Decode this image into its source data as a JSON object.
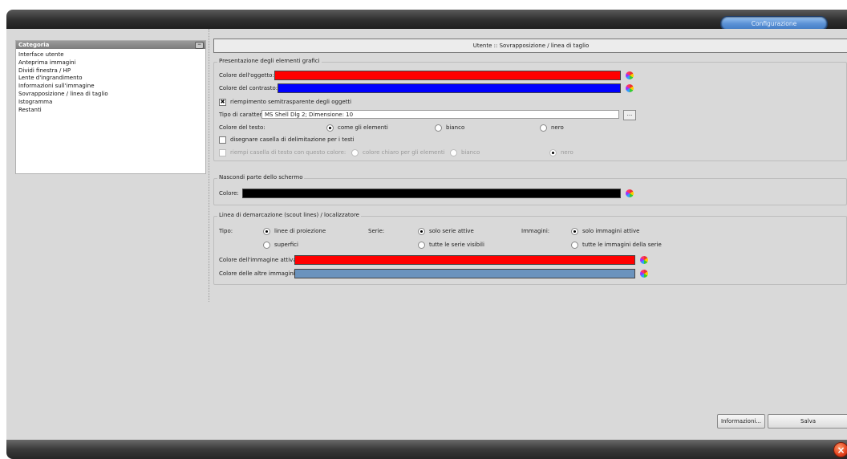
{
  "window": {
    "config_button": "Configurazione"
  },
  "sidebar": {
    "title": "Categoria",
    "items": [
      "Interface utente",
      "Anteprima immagini",
      "Dividi finestra / HP",
      "Lente d'ingrandimento",
      "Informazioni sull'immagine",
      "Sovrapposizione / linea di taglio",
      "Istogramma",
      "Restanti"
    ]
  },
  "main": {
    "heading": "Utente :: Sovrapposizione / linea di taglio",
    "graphics": {
      "legend": "Presentazione degli elementi grafici",
      "object_color_label": "Colore dell'oggetto:",
      "object_color": "#ff0000",
      "contrast_color_label": "Colore del contrasto:",
      "contrast_color": "#0000ff",
      "semitransparent_label": "riempimento semitrasparente degli oggetti",
      "semitransparent_checked": true,
      "font_label": "Tipo di carattere:",
      "font_value": "MS Shell Dlg 2; Dimensione: 10",
      "font_button": "...",
      "text_color_label": "Colore del testo:",
      "text_color_options": [
        "come gli elementi",
        "bianco",
        "nero"
      ],
      "text_color_selected": "come gli elementi",
      "bbox_label": "disegnare casella di delimitazione per i testi",
      "bbox_checked": false,
      "fill_box_label": "riempi casella di testo con questo colore:",
      "fill_box_options": [
        "colore chiaro per gli elementi",
        "bianco",
        "nero"
      ],
      "fill_box_selected": "nero"
    },
    "hide": {
      "legend": "Nascondi parte dello schermo",
      "color_label": "Colore:",
      "color": "#000000"
    },
    "scout": {
      "legend": "Linea di demarcazione (scout lines) / localizzatore",
      "tipo_label": "Tipo:",
      "tipo_options": [
        "linee di proiezione",
        "superfici"
      ],
      "tipo_selected": "linee di proiezione",
      "serie_label": "Serie:",
      "serie_options": [
        "solo serie attive",
        "tutte le serie visibili"
      ],
      "serie_selected": "solo serie attive",
      "immagini_label": "Immagini:",
      "immagini_options": [
        "solo immagini attive",
        "tutte le immagini della serie"
      ],
      "immagini_selected": "solo immagini attive",
      "active_color_label": "Colore dell'immagine attiva:",
      "active_color": "#ff0000",
      "other_color_label": "Colore delle altre immagini:",
      "other_color": "#6b93bd"
    }
  },
  "footer": {
    "info_button": "Informazioni...",
    "save_button": "Salva",
    "close_icon": "close-icon"
  }
}
